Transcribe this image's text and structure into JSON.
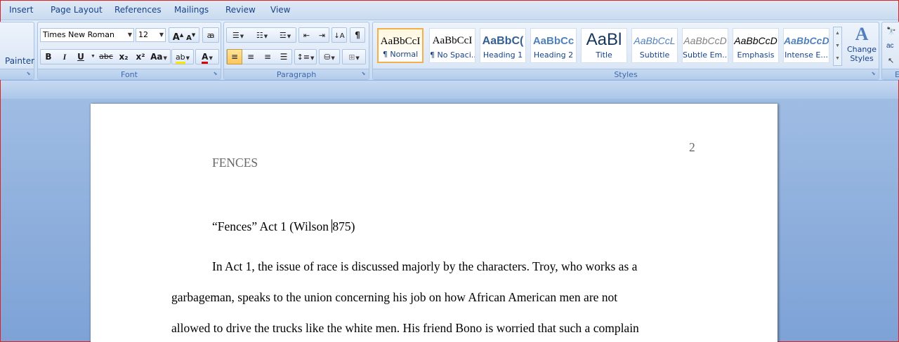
{
  "menu": {
    "tabs": [
      "Insert",
      "Page Layout",
      "References",
      "Mailings",
      "Review",
      "View"
    ]
  },
  "clipboard": {
    "format_painter_label": "Painter"
  },
  "font_group": {
    "label": "Font",
    "font_name": "Times New Roman",
    "font_size": "12",
    "grow_font": "A",
    "shrink_font": "A",
    "bold": "B",
    "italic": "I",
    "underline": "U",
    "strikethrough": "abc",
    "subscript": "x₂",
    "superscript": "x²",
    "change_case": "Aa",
    "font_color_letter": "A"
  },
  "paragraph_group": {
    "label": "Paragraph",
    "show_marks": "¶"
  },
  "styles_group": {
    "label": "Styles",
    "tiles": [
      {
        "sample": "AaBbCcI",
        "name": "¶ Normal"
      },
      {
        "sample": "AaBbCcI",
        "name": "¶ No Spaci..."
      },
      {
        "sample": "AaBbC(",
        "name": "Heading 1"
      },
      {
        "sample": "AaBbCc",
        "name": "Heading 2"
      },
      {
        "sample": "AaBl",
        "name": "Title"
      },
      {
        "sample": "AaBbCcL",
        "name": "Subtitle"
      },
      {
        "sample": "AaBbCcD",
        "name": "Subtle Em..."
      },
      {
        "sample": "AaBbCcD",
        "name": "Emphasis"
      },
      {
        "sample": "AaBbCcD",
        "name": "Intense E..."
      }
    ],
    "change_styles": [
      "Change",
      "Styles"
    ]
  },
  "editing_group": {
    "label": "E"
  },
  "document": {
    "page_number": "2",
    "header": "FENCES",
    "heading_before_caret": "“Fences” Act 1 (Wilson ",
    "heading_after_caret": "875)",
    "para_line1": "In Act 1, the issue of race is discussed majorly by the characters.  Troy, who works as a",
    "para_line2": "garbageman, speaks to the union concerning his job on how African American men are not",
    "para_line3": "allowed to drive the trucks like the white men. His friend Bono is worried that such a complain"
  },
  "colors": {
    "ribbon_text": "#15428b",
    "selected_style_border": "#f1b04b",
    "window_border": "#d42626"
  }
}
